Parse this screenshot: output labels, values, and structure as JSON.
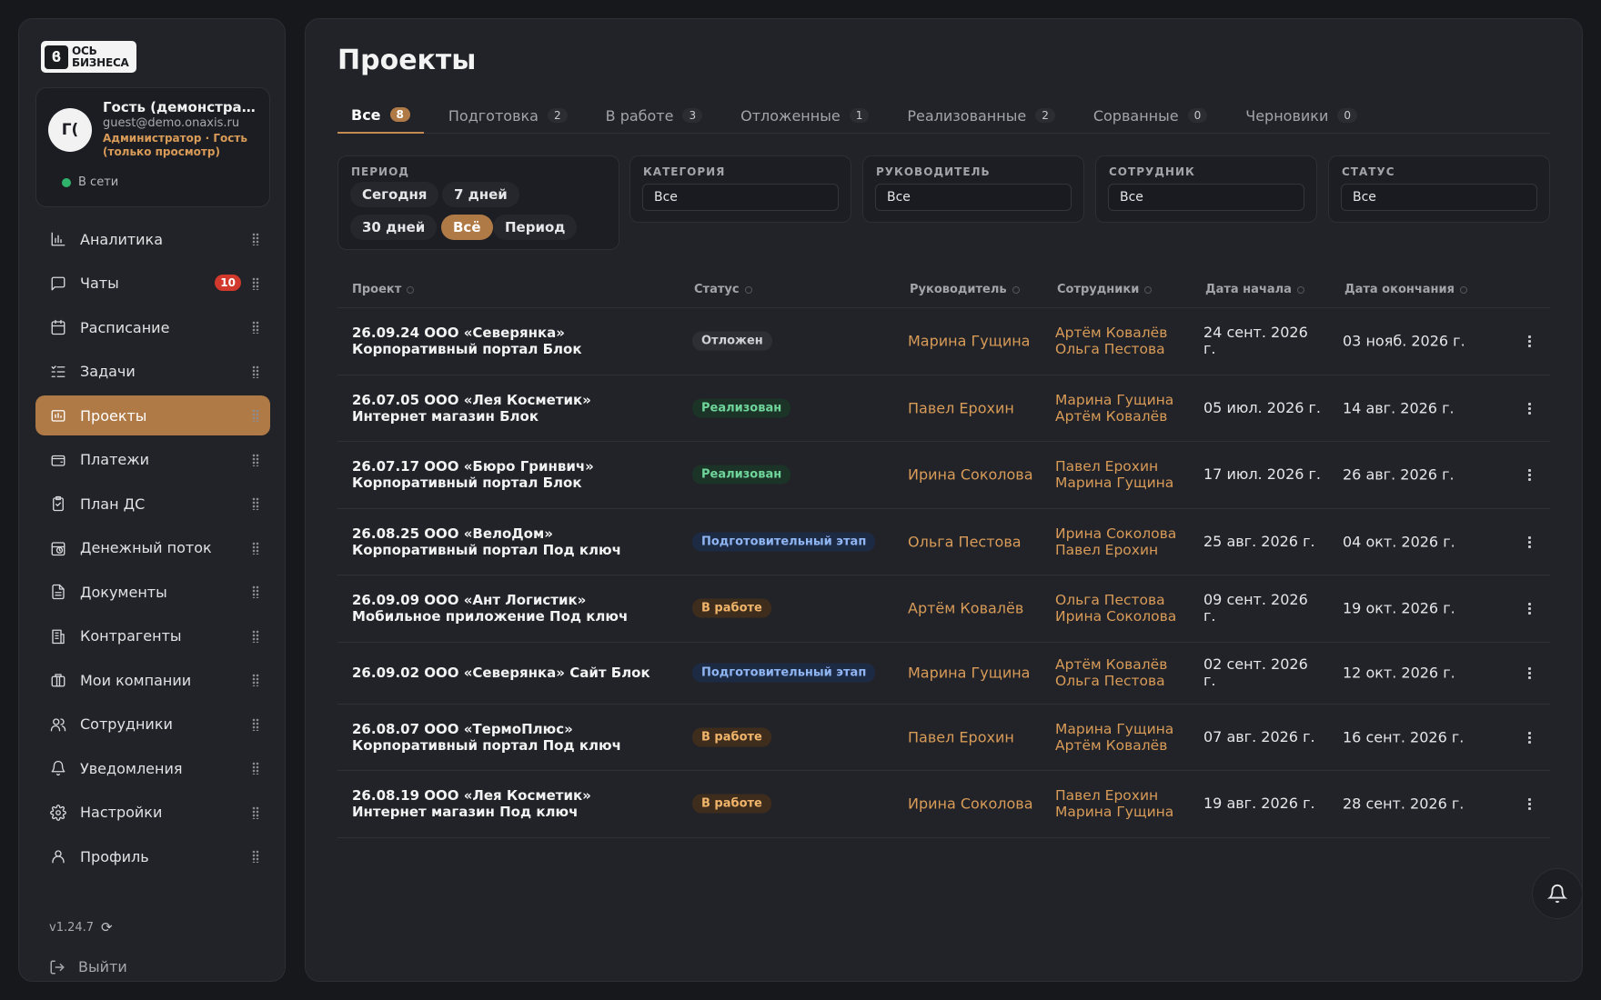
{
  "brand": {
    "logo_mark": "ϐ",
    "logo_line1": "ОСЬ",
    "logo_line2": "БИЗНЕСА"
  },
  "user": {
    "initials": "Г(",
    "name": "Гость (демонстрационный)",
    "email": "guest@demo.onaxis.ru",
    "role": "Администратор · Гость (только просмотр)",
    "status": "В сети"
  },
  "nav": {
    "items": [
      {
        "label": "Аналитика",
        "icon": "chart-icon"
      },
      {
        "label": "Чаты",
        "icon": "chat-icon",
        "badge": "10"
      },
      {
        "label": "Расписание",
        "icon": "calendar-icon"
      },
      {
        "label": "Задачи",
        "icon": "tasks-icon"
      },
      {
        "label": "Проекты",
        "icon": "projects-icon",
        "active": true
      },
      {
        "label": "Платежи",
        "icon": "wallet-icon"
      },
      {
        "label": "План ДС",
        "icon": "clipboard-icon"
      },
      {
        "label": "Денежный поток",
        "icon": "cashflow-icon"
      },
      {
        "label": "Документы",
        "icon": "document-icon"
      },
      {
        "label": "Контрагенты",
        "icon": "building-icon"
      },
      {
        "label": "Мои компании",
        "icon": "briefcase-icon"
      },
      {
        "label": "Сотрудники",
        "icon": "users-icon"
      },
      {
        "label": "Уведомления",
        "icon": "bell-icon"
      },
      {
        "label": "Настройки",
        "icon": "gear-icon"
      },
      {
        "label": "Профиль",
        "icon": "user-icon"
      }
    ]
  },
  "footer": {
    "version": "v1.24.7",
    "logout": "Выйти"
  },
  "page": {
    "title": "Проекты"
  },
  "tabs": [
    {
      "label": "Все",
      "count": "8"
    },
    {
      "label": "Подготовка",
      "count": "2"
    },
    {
      "label": "В работе",
      "count": "3"
    },
    {
      "label": "Отложенные",
      "count": "1"
    },
    {
      "label": "Реализованные",
      "count": "2"
    },
    {
      "label": "Сорванные",
      "count": "0"
    },
    {
      "label": "Черновики",
      "count": "0"
    }
  ],
  "filters": {
    "period": {
      "label": "ПЕРИОД",
      "chips": [
        "Сегодня",
        "7 дней",
        "30 дней",
        "Всё",
        "Период"
      ]
    },
    "category": {
      "label": "КАТЕГОРИЯ",
      "value": "Все"
    },
    "manager": {
      "label": "РУКОВОДИТЕЛЬ",
      "value": "Все"
    },
    "employee": {
      "label": "СОТРУДНИК",
      "value": "Все"
    },
    "status": {
      "label": "СТАТУС",
      "value": "Все"
    }
  },
  "table": {
    "headers": {
      "project": "Проект",
      "status": "Статус",
      "manager": "Руководитель",
      "employees": "Сотрудники",
      "start": "Дата начала",
      "end": "Дата окончания"
    },
    "rows": [
      {
        "p1": "26.09.24 ООО «Северянка»",
        "p2": "Корпоративный портал Блок",
        "status": "Отложен",
        "st": "otl",
        "lead": "Марина Гущина",
        "e1": "Артём Ковалёв",
        "e2": "Ольга Пестова",
        "start": "24 сент. 2026 г.",
        "end": "03 нояб. 2026 г."
      },
      {
        "p1": "26.07.05 ООО «Лея Косметик»",
        "p2": "Интернет магазин Блок",
        "status": "Реализован",
        "st": "real",
        "lead": "Павел Ерохин",
        "e1": "Марина Гущина",
        "e2": "Артём Ковалёв",
        "start": "05 июл. 2026 г.",
        "end": "14 авг. 2026 г."
      },
      {
        "p1": "26.07.17 ООО «Бюро Гринвич»",
        "p2": "Корпоративный портал Блок",
        "status": "Реализован",
        "st": "real",
        "lead": "Ирина Соколова",
        "e1": "Павел Ерохин",
        "e2": "Марина Гущина",
        "start": "17 июл. 2026 г.",
        "end": "26 авг. 2026 г."
      },
      {
        "p1": "26.08.25 ООО «ВелоДом»",
        "p2": "Корпоративный портал Под ключ",
        "status": "Подготовительный этап",
        "st": "prep",
        "lead": "Ольга Пестова",
        "e1": "Ирина Соколова",
        "e2": "Павел Ерохин",
        "start": "25 авг. 2026 г.",
        "end": "04 окт. 2026 г."
      },
      {
        "p1": "26.09.09 ООО «Ант Логистик»",
        "p2": "Мобильное приложение Под ключ",
        "status": "В работе",
        "st": "work",
        "lead": "Артём Ковалёв",
        "e1": "Ольга Пестова",
        "e2": "Ирина Соколова",
        "start": "09 сент. 2026 г.",
        "end": "19 окт. 2026 г."
      },
      {
        "p1": "26.09.02 ООО «Северянка» Сайт Блок",
        "p2": "",
        "status": "Подготовительный этап",
        "st": "prep",
        "lead": "Марина Гущина",
        "e1": "Артём Ковалёв",
        "e2": "Ольга Пестова",
        "start": "02 сент. 2026 г.",
        "end": "12 окт. 2026 г."
      },
      {
        "p1": "26.08.07 ООО «ТермоПлюс»",
        "p2": "Корпоративный портал Под ключ",
        "status": "В работе",
        "st": "work",
        "lead": "Павел Ерохин",
        "e1": "Марина Гущина",
        "e2": "Артём Ковалёв",
        "start": "07 авг. 2026 г.",
        "end": "16 сент. 2026 г."
      },
      {
        "p1": "26.08.19 ООО «Лея Косметик»",
        "p2": "Интернет магазин Под ключ",
        "status": "В работе",
        "st": "work",
        "lead": "Ирина Соколова",
        "e1": "Павел Ерохин",
        "e2": "Марина Гущина",
        "start": "19 авг. 2026 г.",
        "end": "28 сент. 2026 г."
      }
    ]
  },
  "colors": {
    "accent": "#b07a47",
    "link": "#d89b58",
    "online": "#2fb36b"
  }
}
